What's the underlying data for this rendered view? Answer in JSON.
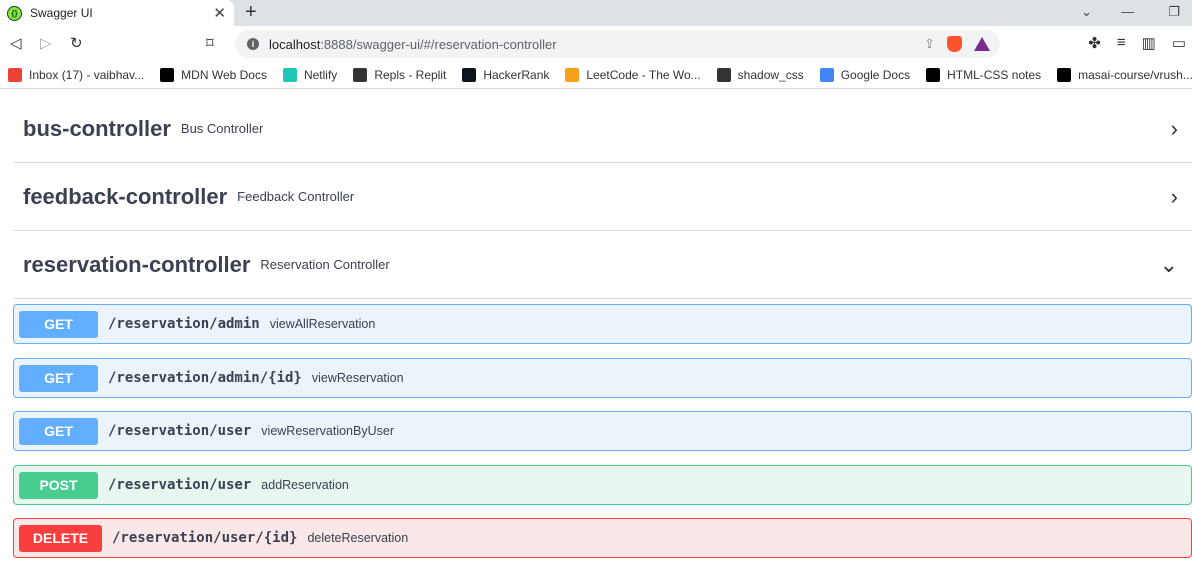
{
  "tab": {
    "title": "Swagger UI",
    "favicon_icon": "swagger-icon"
  },
  "address_bar": {
    "host": "localhost",
    "rest": ":8888/swagger-ui/#/reservation-controller"
  },
  "bookmarks": [
    {
      "label": "Inbox (17) - vaibhav...",
      "icon": "gmail-icon",
      "color": "#ea4335"
    },
    {
      "label": "MDN Web Docs",
      "icon": "mdn-icon",
      "color": "#000000"
    },
    {
      "label": "Netlify",
      "icon": "netlify-icon",
      "color": "#20c6b7"
    },
    {
      "label": "Repls - Replit",
      "icon": "replit-icon",
      "color": "#333333"
    },
    {
      "label": "HackerRank",
      "icon": "hackerrank-icon",
      "color": "#0e141e"
    },
    {
      "label": "LeetCode - The Wo...",
      "icon": "leetcode-icon",
      "color": "#f89f1b"
    },
    {
      "label": "shadow_css",
      "icon": "shadow-css-icon",
      "color": "#333333"
    },
    {
      "label": "Google Docs",
      "icon": "google-docs-icon",
      "color": "#4285f4"
    },
    {
      "label": "HTML-CSS notes",
      "icon": "notion-icon",
      "color": "#000000"
    },
    {
      "label": "masai-course/vrush...",
      "icon": "github-icon",
      "color": "#000000"
    }
  ],
  "tags": [
    {
      "name": "bus-controller",
      "description": "Bus Controller",
      "expanded": false
    },
    {
      "name": "feedback-controller",
      "description": "Feedback Controller",
      "expanded": false
    },
    {
      "name": "reservation-controller",
      "description": "Reservation Controller",
      "expanded": true
    }
  ],
  "operations": [
    {
      "method": "GET",
      "path": "/reservation/admin",
      "summary": "viewAllReservation"
    },
    {
      "method": "GET",
      "path": "/reservation/admin/{id}",
      "summary": "viewReservation"
    },
    {
      "method": "GET",
      "path": "/reservation/user",
      "summary": "viewReservationByUser"
    },
    {
      "method": "POST",
      "path": "/reservation/user",
      "summary": "addReservation"
    },
    {
      "method": "DELETE",
      "path": "/reservation/user/{id}",
      "summary": "deleteReservation"
    }
  ],
  "colors": {
    "get": "#61affe",
    "post": "#49cc90",
    "delete": "#f93e3e",
    "text": "#3b4151"
  }
}
